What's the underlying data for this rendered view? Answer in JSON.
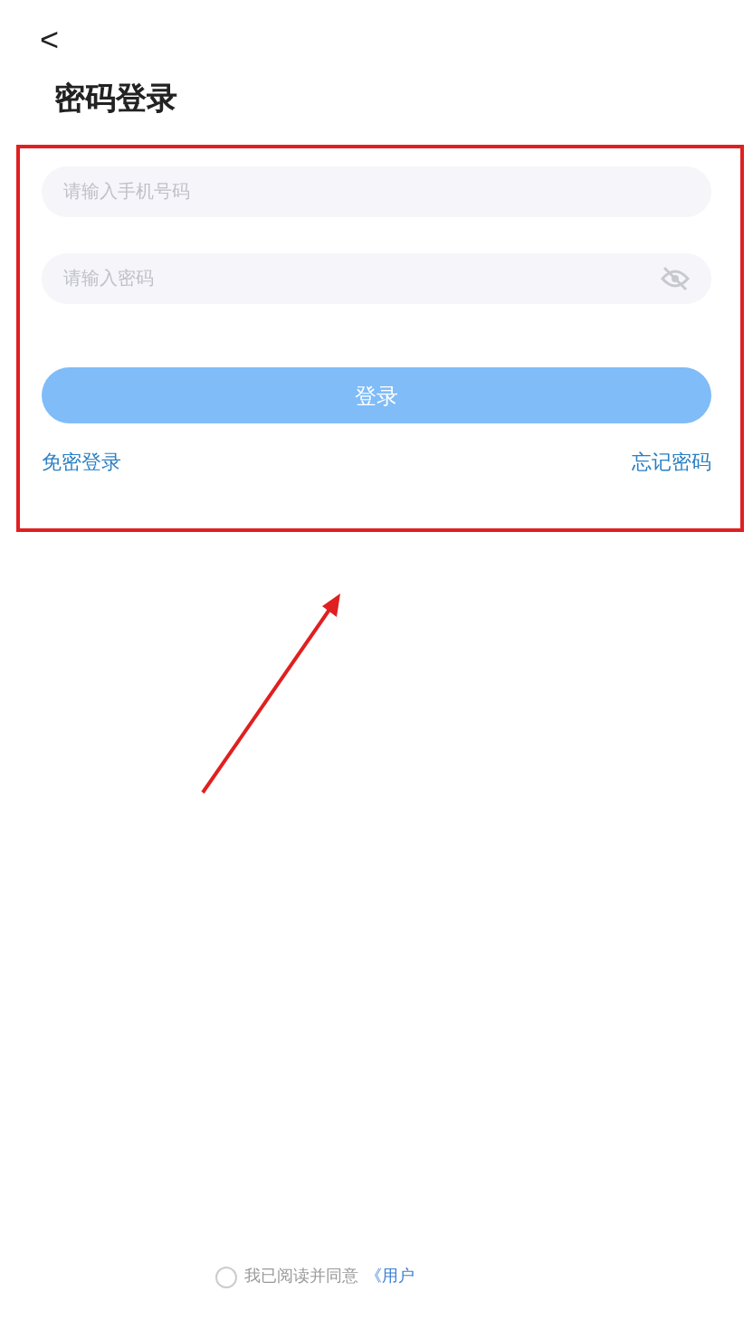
{
  "nav": {
    "back": "<"
  },
  "title": "密码登录",
  "phone_field": {
    "placeholder": "请输入手机号码"
  },
  "password_field": {
    "placeholder": "请输入密码",
    "visible": false
  },
  "login_button": {
    "label": "登录",
    "disabled": true
  },
  "links": [
    {
      "label": "免密登录"
    },
    {
      "label": "忘记密码"
    }
  ],
  "agreement": {
    "checked": false,
    "text": "我已阅读并同意",
    "link": "《用户"
  }
}
